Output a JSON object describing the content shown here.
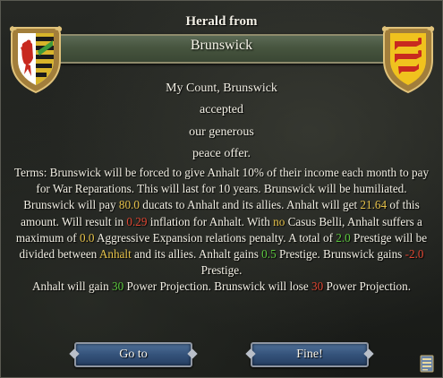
{
  "header": {
    "title": "Herald from",
    "sender": "Brunswick"
  },
  "icons": {
    "left_shield": "anhalt-coat-of-arms-icon",
    "right_shield": "brunswick-coat-of-arms-icon",
    "corner": "ledger-icon"
  },
  "message": {
    "line1": "My Count, Brunswick",
    "line2": "accepted",
    "line3": "our generous",
    "line4": "peace offer."
  },
  "terms": {
    "t1": "Terms: Brunswick will be forced to give Anhalt 10% of their income each month to pay for War Reparations. This will last for 10 years. Brunswick will be humiliated. Brunswick will pay ",
    "ducats": "80.0",
    "t2": " ducats to Anhalt and its allies. Anhalt will get ",
    "anhalt_share": "21.64",
    "t3": " of this amount. Will result in ",
    "inflation": "0.29",
    "t4": " inflation for Anhalt. With ",
    "no_word": "no",
    "t5": " Casus Belli, Anhalt suffers a maximum of ",
    "ae": "0.0",
    "t6": " Aggressive Expansion relations penalty. A total of ",
    "prestige_total": "2.0",
    "t7": " Prestige will be divided between ",
    "anhalt_name": "Anhalt",
    "t8": " and its allies. Anhalt gains ",
    "anhalt_prestige": "0.5",
    "t9": " Prestige. Brunswick gains ",
    "brunswick_prestige": "-2.0",
    "t10": " Prestige.",
    "t11": "Anhalt will gain ",
    "pp_gain": "30",
    "t12": " Power Projection. Brunswick will lose ",
    "pp_loss": "30",
    "t13": " Power Projection."
  },
  "buttons": {
    "goto_label": "Go to",
    "fine_label": "Fine!"
  },
  "colors": {
    "positive": "#5cc83e",
    "negative": "#e04632",
    "highlight": "#e6c24a",
    "button": "#34527a",
    "banner": "#47553f"
  }
}
